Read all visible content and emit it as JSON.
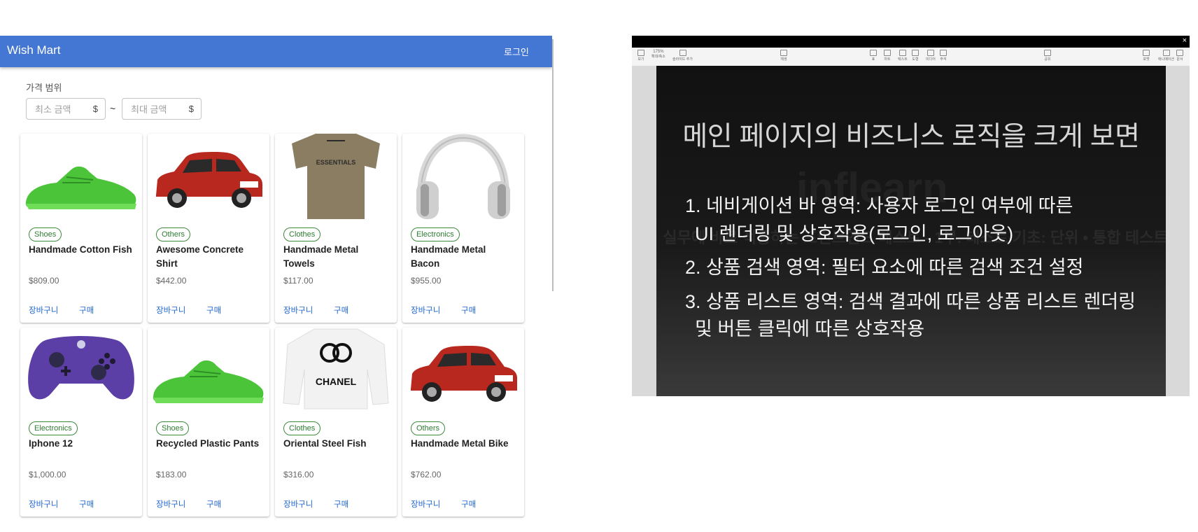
{
  "app": {
    "title": "Wish Mart",
    "login_label": "로그인",
    "filter": {
      "label": "가격 범위",
      "min_placeholder": "최소 금액",
      "max_placeholder": "최대 금액",
      "currency": "$",
      "separator": "~"
    },
    "products": [
      {
        "category": "Shoes",
        "name": "Handmade Cotton Fish",
        "price": "$809.00",
        "cart": "장바구니",
        "buy": "구매",
        "image": "green-sneaker"
      },
      {
        "category": "Others",
        "name": "Awesome Concrete Shirt",
        "price": "$442.00",
        "cart": "장바구니",
        "buy": "구매",
        "image": "red-car"
      },
      {
        "category": "Clothes",
        "name": "Handmade Metal Towels",
        "price": "$117.00",
        "cart": "장바구니",
        "buy": "구매",
        "image": "tan-tshirt"
      },
      {
        "category": "Electronics",
        "name": "Handmade Metal Bacon",
        "price": "$955.00",
        "cart": "장바구니",
        "buy": "구매",
        "image": "silver-headphones"
      },
      {
        "category": "Electronics",
        "name": "Iphone 12",
        "price": "$1,000.00",
        "cart": "장바구니",
        "buy": "구매",
        "image": "purple-game-controller"
      },
      {
        "category": "Shoes",
        "name": "Recycled Plastic Pants",
        "price": "$183.00",
        "cart": "장바구니",
        "buy": "구매",
        "image": "green-sneaker"
      },
      {
        "category": "Clothes",
        "name": "Oriental Steel Fish",
        "price": "$316.00",
        "cart": "장바구니",
        "buy": "구매",
        "image": "white-sweatshirt"
      },
      {
        "category": "Others",
        "name": "Handmade Metal Bike",
        "price": "$762.00",
        "cart": "장바구니",
        "buy": "구매",
        "image": "red-car"
      }
    ],
    "brand_text": {
      "essentials": "ESSENTIALS",
      "chanel": "CHANEL"
    }
  },
  "viewer": {
    "close": "×",
    "toolbar": [
      "보기",
      "확대/축소",
      "슬라이드 추가",
      "재생",
      "표",
      "차트",
      "텍스트",
      "도형",
      "미디어",
      "주석",
      "공유",
      "포맷",
      "애니메이션",
      "문서"
    ],
    "zoom": "175%",
    "slide": {
      "title": "메인 페이지의 비즈니스 로직을 크게 보면",
      "lines": [
        "1. 네비게이션 바 영역: 사용자 로그인 여부에 따른",
        "UI 렌더링 및 상호작용(로그인, 로그아웃)",
        "2. 상품 검색 영역: 필터 요소에 따른 검색 조건 설정",
        "3. 상품 리스트 영역: 검색 결과에 따른 상품 리스트 렌더링",
        "및 버튼 클릭에 따른 상호작용"
      ],
      "watermark": "실무에 바로 적용하는 프런트엔드 테스트 - 1부. 테스트 기초: 단위 • 통합 테스트",
      "watermark_logo": "inflearn"
    }
  }
}
